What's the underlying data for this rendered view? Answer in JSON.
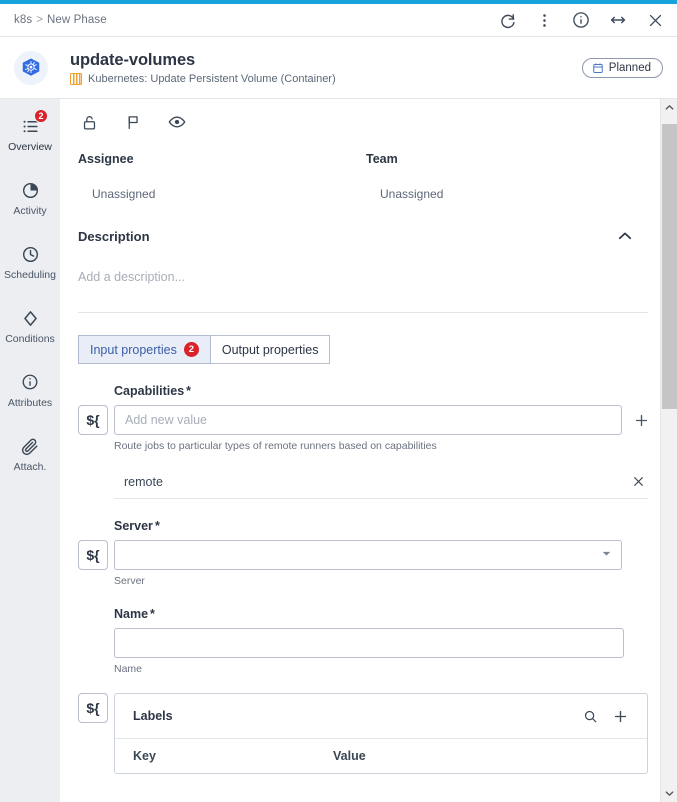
{
  "theme": {
    "accent": "#19A3DB",
    "badge_red": "#D8232A",
    "tab_active_bg": "#e8edf7",
    "tab_active_text": "#3b5ea8",
    "sidebar_bg": "#eceef2",
    "k8s_blue": "#326CE5",
    "orange": "#F0A030"
  },
  "topbar": {
    "breadcrumb": {
      "root": "k8s",
      "separator": ">",
      "current": "New Phase"
    },
    "icons": [
      {
        "name": "refresh-icon",
        "label": "Refresh"
      },
      {
        "name": "more-vertical-icon",
        "label": "More options"
      },
      {
        "name": "info-icon",
        "label": "Info"
      },
      {
        "name": "expand-horizontal-icon",
        "label": "Expand"
      },
      {
        "name": "close-icon",
        "label": "Close"
      }
    ]
  },
  "header": {
    "logo": "kubernetes-logo",
    "title": "update-volumes",
    "subtitle": "Kubernetes: Update Persistent Volume (Container)",
    "subtitle_icon": "container-icon",
    "status": {
      "icon": "calendar-icon",
      "label": "Planned"
    }
  },
  "sidebar": {
    "items": [
      {
        "label": "Overview",
        "icon": "list-icon",
        "badge": "2",
        "active": true
      },
      {
        "label": "Activity",
        "icon": "pie-icon",
        "badge": null,
        "active": false
      },
      {
        "label": "Scheduling",
        "icon": "clock-icon",
        "badge": null,
        "active": false
      },
      {
        "label": "Conditions",
        "icon": "diamond-icon",
        "badge": null,
        "active": false
      },
      {
        "label": "Attributes",
        "icon": "info-icon",
        "badge": null,
        "active": false
      },
      {
        "label": "Attach.",
        "icon": "paperclip-icon",
        "badge": null,
        "active": false
      }
    ]
  },
  "toolbar": {
    "icons": [
      {
        "name": "unlock-icon",
        "label": "Lock"
      },
      {
        "name": "flag-icon",
        "label": "Flag"
      },
      {
        "name": "eye-icon",
        "label": "Watch"
      }
    ]
  },
  "meta": {
    "assignee": {
      "label": "Assignee",
      "value": "Unassigned"
    },
    "team": {
      "label": "Team",
      "value": "Unassigned"
    }
  },
  "description": {
    "title": "Description",
    "placeholder": "Add a description...",
    "collapse_icon": "chevron-up-icon",
    "expanded": true
  },
  "tabs": [
    {
      "label": "Input properties",
      "badge": "2",
      "active": true
    },
    {
      "label": "Output properties",
      "badge": null,
      "active": false
    }
  ],
  "form": {
    "capabilities": {
      "label": "Capabilities",
      "required": "*",
      "expr_button": "${",
      "input_value": "",
      "input_placeholder": "Add new value",
      "add_button": "+",
      "help": "Route jobs to particular types of remote runners based on capabilities",
      "values": [
        {
          "text": "remote",
          "remove_icon": "close-icon"
        }
      ]
    },
    "server": {
      "label": "Server",
      "required": "*",
      "expr_button": "${",
      "value": "",
      "caret_icon": "chevron-down-icon",
      "help": "Server"
    },
    "name": {
      "label": "Name",
      "required": "*",
      "value": "",
      "help": "Name"
    },
    "labels": {
      "expr_button": "${",
      "title": "Labels",
      "search_icon": "search-icon",
      "add_icon": "plus-icon",
      "columns": [
        "Key",
        "Value"
      ],
      "rows": []
    }
  },
  "scrollbar": {
    "up_icon": "chevron-up-icon",
    "down_icon": "chevron-down-icon"
  }
}
